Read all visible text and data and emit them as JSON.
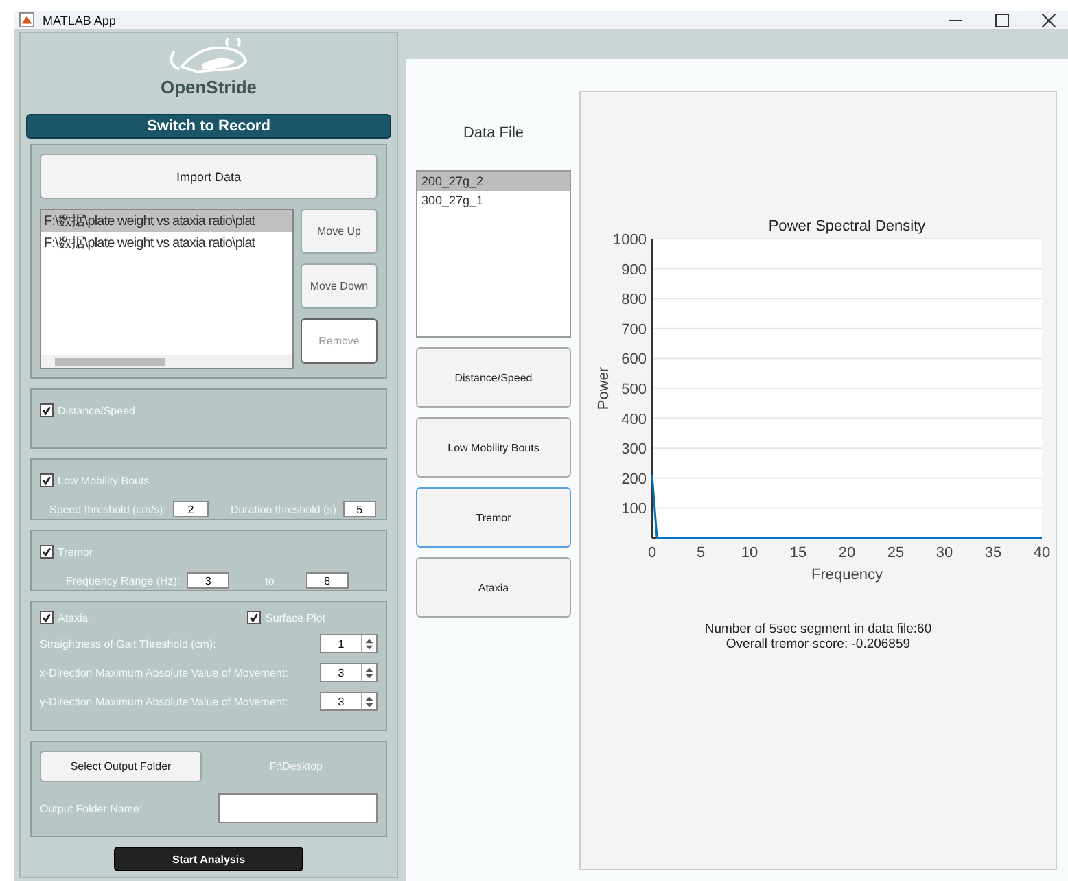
{
  "window": {
    "title": "MATLAB App"
  },
  "logo": {
    "text": "OpenStride"
  },
  "switch_button": {
    "label": "Switch to Record"
  },
  "import": {
    "button": "Import Data",
    "files": [
      {
        "text": "F:\\数据\\plate weight vs ataxia ratio\\plat",
        "selected": true
      },
      {
        "text": "F:\\数据\\plate weight vs ataxia ratio\\plat",
        "selected": false
      }
    ],
    "buttons": [
      {
        "label": "Move Up",
        "disabled": false
      },
      {
        "label": "Move Down",
        "disabled": false
      },
      {
        "label": "Remove",
        "disabled": true
      }
    ]
  },
  "distance_speed": {
    "label": "Distance/Speed",
    "checked": true
  },
  "low_mobility": {
    "label": "Low Mobility Bouts",
    "checked": true,
    "speed_label": "Speed threshold (cm/s):",
    "speed_value": "2",
    "duration_label": "Duration threshold (s)",
    "duration_value": "5"
  },
  "tremor": {
    "label": "Tremor",
    "checked": true,
    "range_label": "Frequency Range (Hz):",
    "from_value": "3",
    "to_label": "to",
    "to_value": "8"
  },
  "ataxia": {
    "label": "Ataxia",
    "checked": true,
    "surface_plot": {
      "label": "Surface Plot",
      "checked": true
    },
    "spinners": [
      {
        "label": "Straightness of Gait Threshold (cm):",
        "value": "1"
      },
      {
        "label": "x-Direction Maximum Absolute Value of Movement:",
        "value": "3"
      },
      {
        "label": "y-Direction Maximum Absolute Value of Movement:",
        "value": "3"
      }
    ]
  },
  "output": {
    "button": "Select Output Folder",
    "path": "F:\\Desktop",
    "name_label": "Output Folder Name:"
  },
  "start_button": {
    "label": "Start Analysis"
  },
  "data_file": {
    "title": "Data File",
    "items": [
      {
        "text": "200_27g_2",
        "selected": true
      },
      {
        "text": "300_27g_1",
        "selected": false
      }
    ]
  },
  "analysis_buttons": [
    {
      "label": "Distance/Speed",
      "selected": false
    },
    {
      "label": "Low Mobility Bouts",
      "selected": false
    },
    {
      "label": "Tremor",
      "selected": true
    },
    {
      "label": "Ataxia",
      "selected": false
    }
  ],
  "chart_data": {
    "type": "line",
    "title": "Power Spectral Density",
    "xlabel": "Frequency",
    "ylabel": "Power",
    "x": [
      0,
      0.5,
      1,
      40
    ],
    "grid": true,
    "series": [
      {
        "color": "#0072bd",
        "values": [
          210,
          0,
          0,
          0
        ]
      }
    ],
    "xlim": [
      0,
      40
    ],
    "ylim": [
      0,
      1000
    ],
    "xticks": [
      0,
      5,
      10,
      15,
      20,
      25,
      30,
      35,
      40
    ],
    "yticks": [
      100,
      200,
      300,
      400,
      500,
      600,
      700,
      800,
      900,
      1000
    ]
  },
  "results": [
    "Number of 5sec segment in data file:60",
    "Overall tremor score: -0.206859"
  ]
}
